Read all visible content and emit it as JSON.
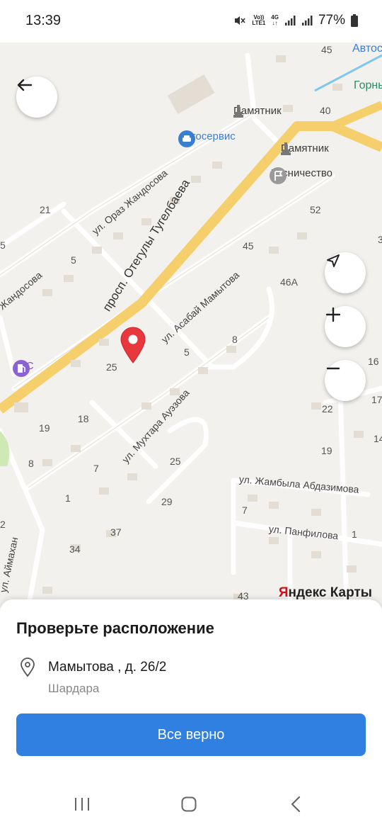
{
  "status_bar": {
    "time": "13:39",
    "volte_top": "Vo))",
    "volte_bottom": "LTE1",
    "network": "4G",
    "battery": "77%"
  },
  "map": {
    "streets": {
      "main_avenue": "просп. Отегулы Тугелбаева",
      "oraz_zhandosov": "ул. Ораз Жандосова",
      "zhandosov_left": "Жандосова",
      "asabai_mamytov": "ул. Асабай Мамытова",
      "mukhtar_auezov": "ул. Мухтара Ауэзова",
      "zhambyl_abdazimov": "ул. Жамбыла Абдазимова",
      "panfilov": "ул. Панфилова",
      "aimakhan": "ул. Аймахан"
    },
    "pois": {
      "monument_1": "Памятник",
      "monument_2": "Памятник",
      "autoservice": "Автосервис",
      "forestry": "Лесничество",
      "gas_station": "АЗС",
      "autos_cut": "Автос",
      "gorny_cut": "Горны"
    },
    "house_numbers": [
      "45",
      "40",
      "21",
      "52",
      "5",
      "45",
      "46А",
      "5",
      "8",
      "25",
      "5",
      "16",
      "19",
      "18",
      "22",
      "8",
      "7",
      "25",
      "19",
      "17",
      "1",
      "29",
      "7",
      "14",
      "2",
      "37",
      "1",
      "34",
      "43",
      "3"
    ],
    "attribution_y": "Я",
    "attribution_rest": "ндекс Карты"
  },
  "sheet": {
    "title": "Проверьте расположение",
    "address": "Мамытова , д. 26/2",
    "city": "Шардара",
    "confirm_label": "Все верно"
  },
  "colors": {
    "accent": "#2f80e0",
    "pin": "#e8383d",
    "main_road": "#f5cf6b"
  }
}
